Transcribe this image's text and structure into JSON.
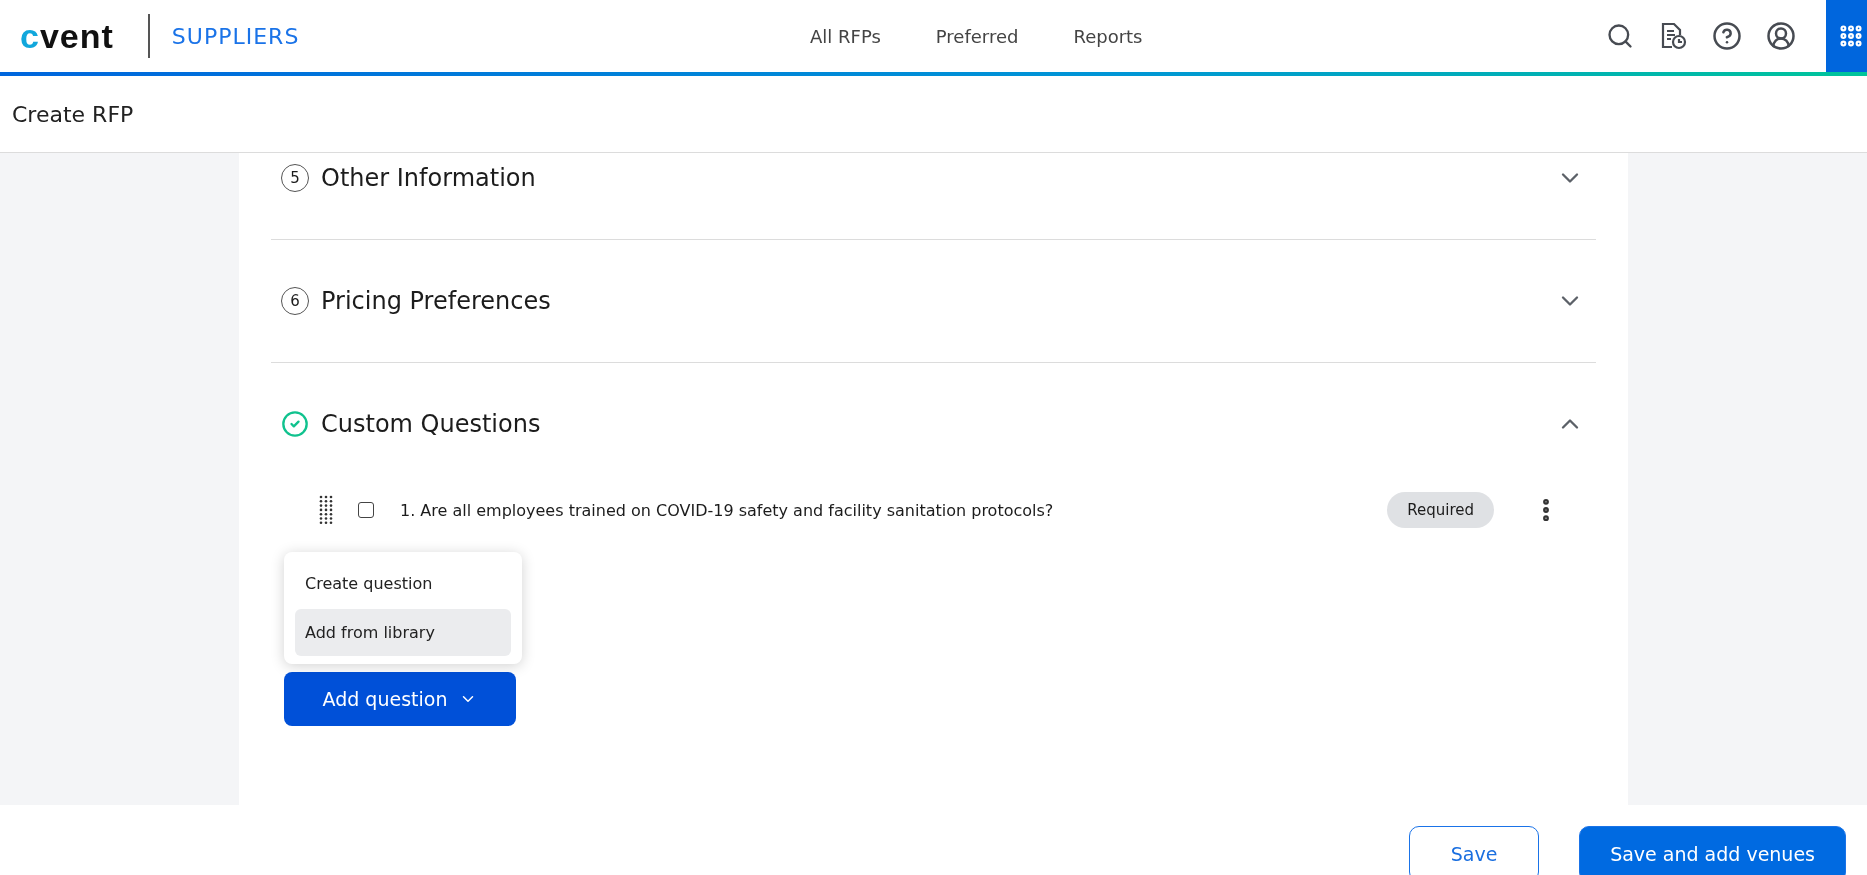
{
  "brand": {
    "logo": "cvent",
    "product": "SUPPLIERS"
  },
  "nav": [
    {
      "label": "All RFPs",
      "selected": false
    },
    {
      "label": "Preferred",
      "selected": false
    },
    {
      "label": "Reports",
      "selected": false
    }
  ],
  "page_title": "Create RFP",
  "sections": [
    {
      "kind": "numbered",
      "number": "5",
      "title": "Other Information",
      "expanded": false
    },
    {
      "kind": "numbered",
      "number": "6",
      "title": "Pricing Preferences",
      "expanded": false
    },
    {
      "kind": "complete",
      "title": "Custom Questions",
      "expanded": true,
      "questions": [
        {
          "text": "1. Are all employees trained on COVID-19 safety and facility sanitation protocols?",
          "checked": false,
          "badge": "Required"
        }
      ],
      "menu": [
        {
          "label": "Create question",
          "selected": false
        },
        {
          "label": "Add from library",
          "selected": true
        }
      ],
      "add_button": "Add question"
    }
  ],
  "footer": {
    "buttons": [
      {
        "label": "Save",
        "kind": "secondary"
      },
      {
        "label": "Save and add venues",
        "kind": "primary"
      }
    ]
  }
}
